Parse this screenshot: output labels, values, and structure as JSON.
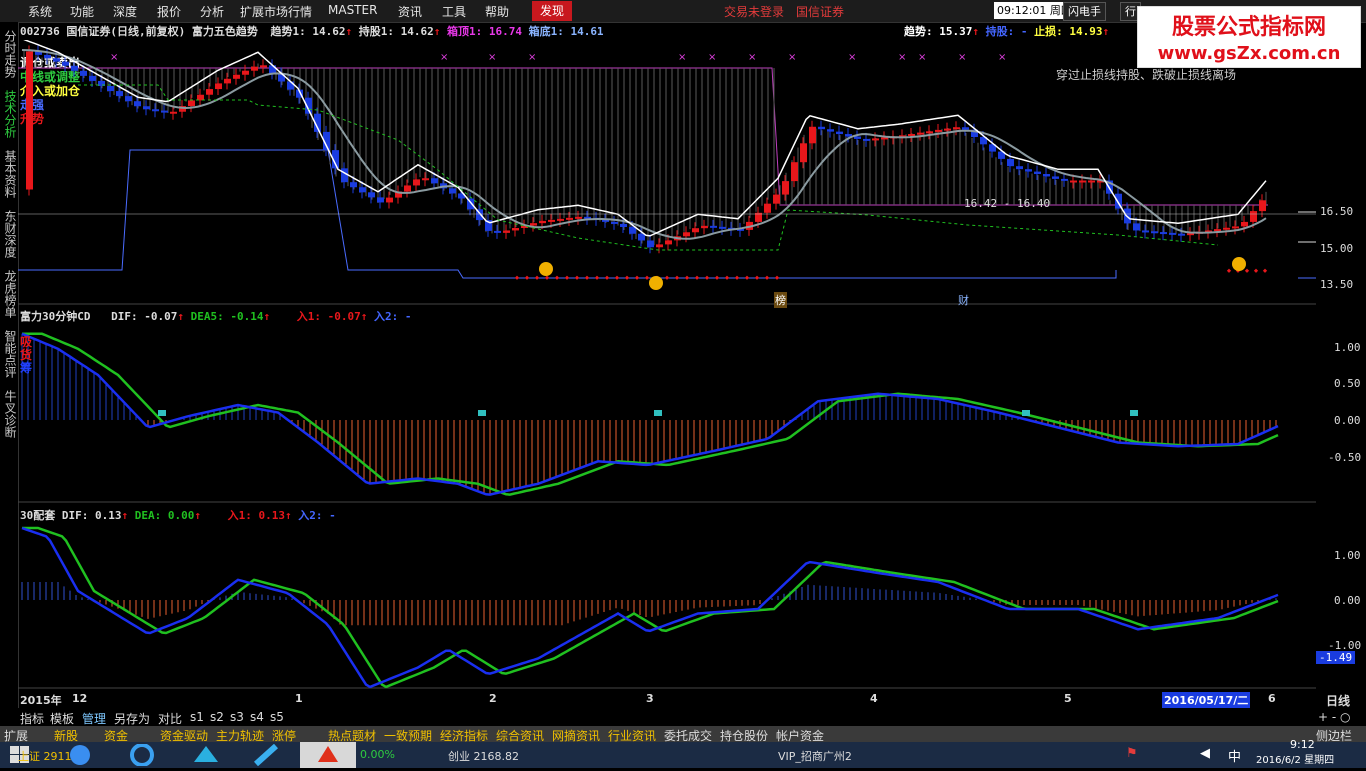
{
  "menubar": {
    "items": [
      "系统",
      "功能",
      "深度",
      "报价",
      "分析",
      "扩展市场行情",
      "MASTER",
      "资讯",
      "工具",
      "帮助"
    ],
    "discover_label": "发现",
    "trade_status": "交易未登录",
    "broker": "国信证券",
    "clock": "09:12:01",
    "weekday": "周四",
    "flash_trade": "闪电手",
    "row_label": "行"
  },
  "watermark": {
    "title": "股票公式指标网",
    "url": "www.gsZx.com.cn"
  },
  "sidebar": {
    "tabs": [
      "分时走势",
      "技术分析",
      "基本资料",
      "东财深度",
      "龙虎榜单",
      "智能点评",
      "牛叉诊断"
    ]
  },
  "main_chart": {
    "header": {
      "code": "002736",
      "name": "国信证券(日线,前复权)",
      "indicator": "富力五色趋势",
      "trend1": "趋势1: 14.62",
      "hold1": "持股1: 14.62",
      "box_top": "箱顶1: 16.74",
      "box_bottom": "箱底1: 14.61",
      "trend": "趋势: 15.37",
      "hold": "持股:  -",
      "stop": "止损: 14.93"
    },
    "legend": [
      "调仓或卖出",
      "中线或调整",
      "介入或加仓",
      "走强",
      "升势"
    ],
    "note": "穿过止损线持股、跌破止损线离场",
    "range_label": "16.42 - 16.40",
    "marker_bang": "榜",
    "marker_cai": "财"
  },
  "panel2": {
    "name": "富力30分钟CD",
    "dif": "DIF: -0.07",
    "dea": "DEA5: -0.14",
    "in1": "入1: -0.07",
    "in2": "入2: -",
    "side_labels": [
      "吸",
      "货",
      "筹"
    ]
  },
  "panel3": {
    "name": "30配套",
    "dif": "DIF: 0.13",
    "dea": "DEA: 0.00",
    "in1": "入1: 0.13",
    "in2": "入2: -",
    "current": "-1.49"
  },
  "axis": {
    "main": [
      "16.50",
      "15.00",
      "13.50"
    ],
    "p2": [
      "1.00",
      "0.50",
      "0.00",
      "-0.50"
    ],
    "p3": [
      "1.00",
      "0.00",
      "-1.00"
    ]
  },
  "dates": {
    "year": "2015年",
    "labels": [
      "12",
      "1",
      "2",
      "3",
      "4",
      "5",
      "6"
    ],
    "current": "2016/05/17/二",
    "period": "日线"
  },
  "toolbar": {
    "items": [
      "指标",
      "模板",
      "管理",
      "另存为",
      "对比",
      "s1",
      "s2",
      "s3",
      "s4",
      "s5"
    ],
    "right": "+  -  ○"
  },
  "quickbar": {
    "items": [
      "扩展",
      "新股",
      "资金",
      "资金驱动",
      "主力轨迹",
      "涨停",
      "热点题材",
      "一致预期",
      "经济指标",
      "综合资讯",
      "网摘资讯",
      "行业资讯",
      "委托成交",
      "持仓股份",
      "帐户资金"
    ],
    "side": "侧边栏"
  },
  "taskbar": {
    "ticker1": "上证 2911",
    "pct1": "0.00%",
    "ticker2": "创业 2168.82",
    "vip": "VIP_招商广州2",
    "time": "9:12",
    "date": "2016/6/2 星期四"
  },
  "colors": {
    "up": "#e8171b",
    "down": "#1a3ce0",
    "ma": "#8a9aa0",
    "dif": "#1a2ff0",
    "dea": "#20c020"
  }
}
